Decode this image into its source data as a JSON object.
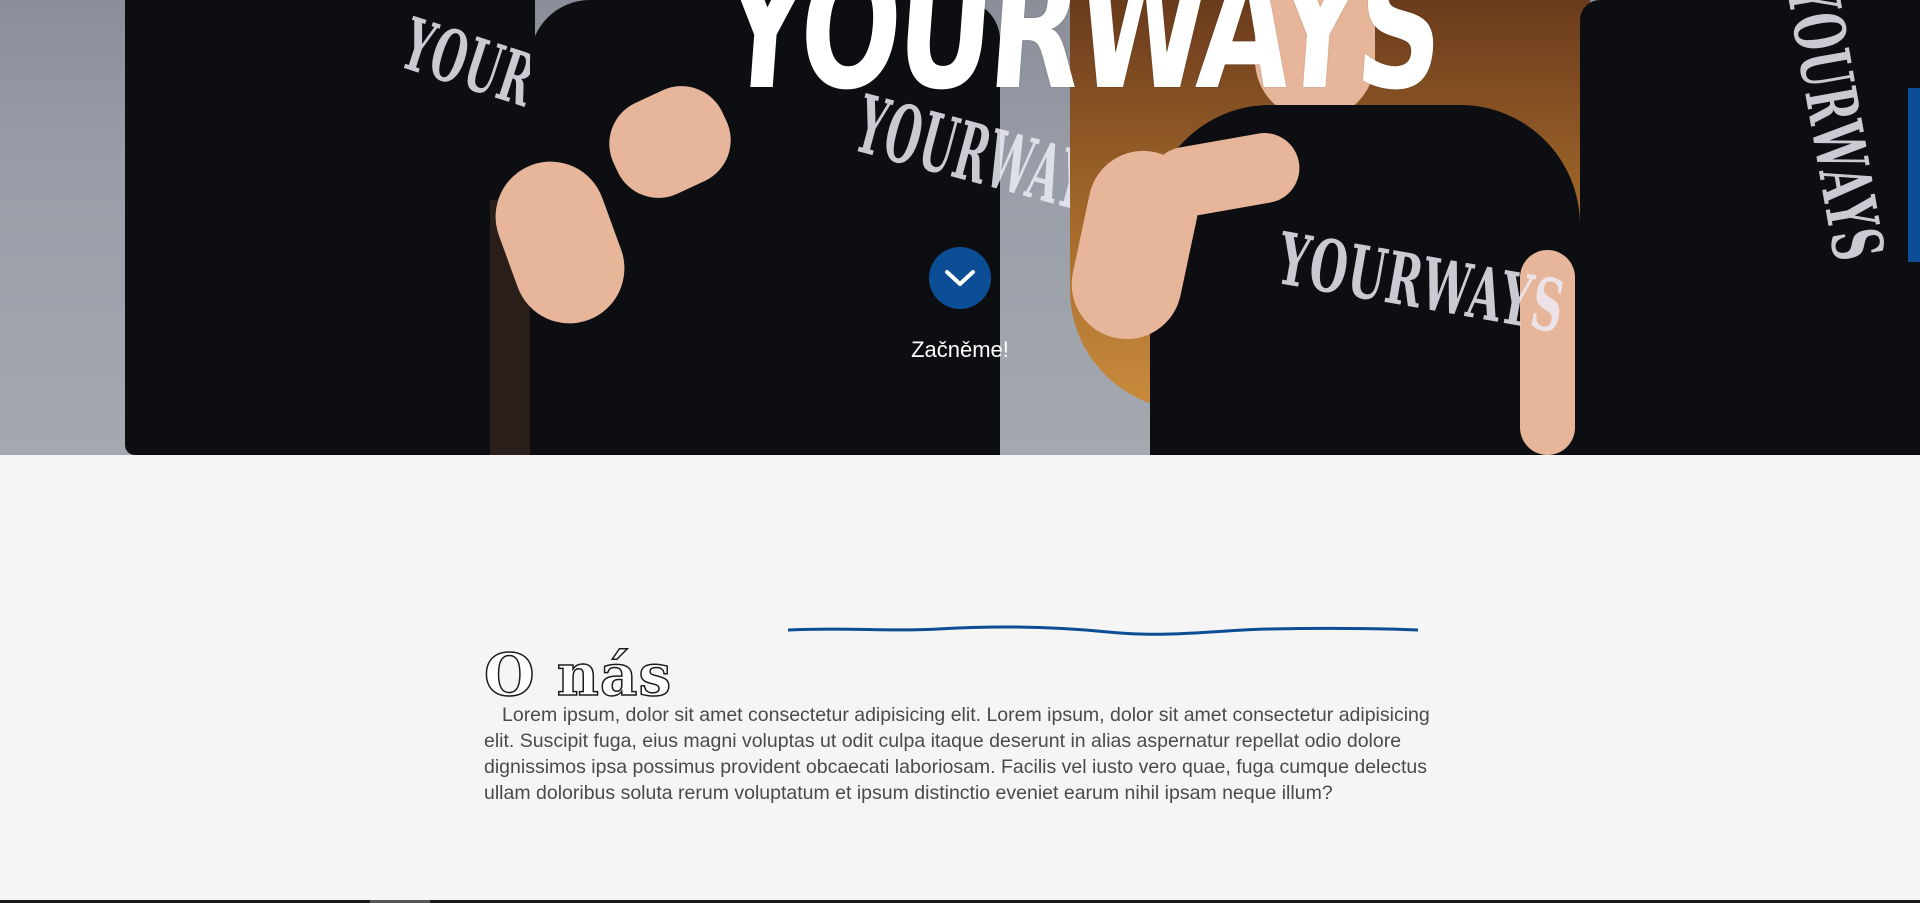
{
  "hero": {
    "title": "YOURWAYS",
    "shirt_print": "YOURWAYS",
    "cta_label": "Začněme!",
    "scroll_icon": "chevron-down-icon"
  },
  "about": {
    "title": "O nás",
    "paragraph": "Lorem ipsum, dolor sit amet consectetur adipisicing elit. Lorem ipsum, dolor sit amet consectetur adipisicing elit. Suscipit fuga, eius magni voluptas ut odit culpa itaque deserunt in alias aspernatur repellat odio dolore dignissimos ipsa possimus provident obcaecati laboriosam. Facilis vel iusto vero quae, fuga cumque delectus ullam doloribus soluta rerum voluptatum et ipsum distinctio eveniet earum nihil ipsam neque illum?"
  },
  "colors": {
    "accent": "#0c4e96",
    "background": "#f5f5f5",
    "text": "#4a4a4a"
  }
}
